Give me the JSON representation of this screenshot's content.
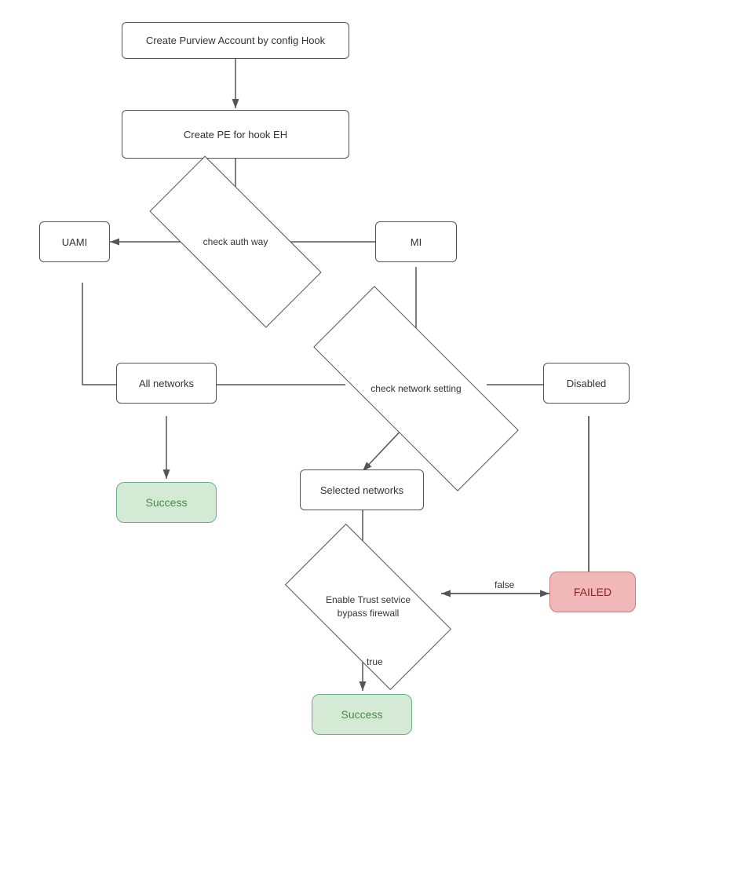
{
  "nodes": {
    "create_purview": {
      "label": "Create Purview Account by config Hook"
    },
    "create_pe": {
      "label": "Create PE for hook EH"
    },
    "check_auth": {
      "label": "check auth way"
    },
    "uami": {
      "label": "UAMI"
    },
    "mi": {
      "label": "MI"
    },
    "check_network": {
      "label": "check network setting"
    },
    "all_networks": {
      "label": "All networks"
    },
    "selected_networks": {
      "label": "Selected networks"
    },
    "disabled": {
      "label": "Disabled"
    },
    "enable_trust": {
      "label": "Enable Trust setvice\nbypass firewall"
    },
    "success1": {
      "label": "Success"
    },
    "success2": {
      "label": "Success"
    },
    "failed": {
      "label": "FAILED"
    }
  },
  "arrow_labels": {
    "false_label": "false",
    "true_label": "true"
  }
}
